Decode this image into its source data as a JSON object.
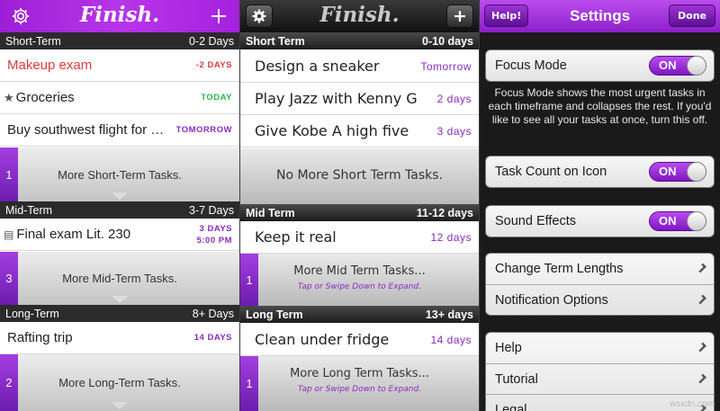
{
  "panel1": {
    "logo": "Finish.",
    "icons": {
      "settings": "gear-icon",
      "add": "plus-icon"
    },
    "short_term": {
      "title": "Short-Term",
      "range": "0-2 Days"
    },
    "short_tasks": [
      {
        "title": "Makeup exam",
        "due": "-2 DAYS",
        "color": "#e23b3b"
      },
      {
        "title": "Groceries",
        "due": "TODAY",
        "color": "#2fb44d",
        "icon": "star-icon"
      },
      {
        "title": "Buy southwest flight for S...",
        "due": "TOMORROW",
        "color": "#8a2bc0"
      }
    ],
    "short_more": {
      "count": "1",
      "label": "More Short-Term Tasks."
    },
    "mid_term": {
      "title": "Mid-Term",
      "range": "3-7 Days"
    },
    "mid_tasks": [
      {
        "title": "Final exam Lit. 230",
        "due": "3 DAYS",
        "time": "5:00 PM",
        "icon": "note-icon"
      }
    ],
    "mid_more": {
      "count": "3",
      "label": "More Mid-Term Tasks."
    },
    "long_term": {
      "title": "Long-Term",
      "range": "8+ Days"
    },
    "long_tasks": [
      {
        "title": "Rafting trip",
        "due": "14 DAYS"
      }
    ],
    "long_more": {
      "count": "2",
      "label": "More Long-Term Tasks."
    }
  },
  "panel2": {
    "logo": "Finish.",
    "icons": {
      "settings": "gear-icon",
      "add": "plus-icon"
    },
    "short_term": {
      "title": "Short Term",
      "range": "0-10 days"
    },
    "short_tasks": [
      {
        "title": "Design a sneaker",
        "due": "Tomorrow"
      },
      {
        "title": "Play Jazz with Kenny G",
        "due": "2 days"
      },
      {
        "title": "Give Kobe A high five",
        "due": "3 days"
      }
    ],
    "short_empty": "No More Short Term Tasks.",
    "mid_term": {
      "title": "Mid Term",
      "range": "11-12 days"
    },
    "mid_tasks": [
      {
        "title": "Keep it real",
        "due": "12 days"
      }
    ],
    "mid_more": {
      "count": "1",
      "label": "More Mid Term Tasks...",
      "hint": "Tap or Swipe Down to Expand."
    },
    "long_term": {
      "title": "Long Term",
      "range": "13+ days"
    },
    "long_tasks": [
      {
        "title": "Clean under fridge",
        "due": "14 days"
      }
    ],
    "long_more": {
      "count": "1",
      "label": "More Long Term Tasks...",
      "hint": "Tap or Swipe Down to Expand."
    }
  },
  "panel3": {
    "help_button": "Help!",
    "title": "Settings",
    "done_button": "Done",
    "focus_mode": {
      "label": "Focus Mode",
      "state": "ON"
    },
    "focus_note": "Focus Mode shows the most urgent tasks in each timeframe and collapses the rest. If you'd like to see all your tasks at once, turn this off.",
    "task_count": {
      "label": "Task Count on Icon",
      "state": "ON"
    },
    "sound_effects": {
      "label": "Sound Effects",
      "state": "ON"
    },
    "nav1": [
      "Change Term Lengths",
      "Notification Options"
    ],
    "nav2": [
      "Help",
      "Tutorial",
      "Legal"
    ]
  },
  "watermark": "wsxdn.com",
  "colors": {
    "accent": "#9d1fd6",
    "today": "#2fb44d",
    "overdue": "#e23b3b",
    "date": "#8a2bc0"
  }
}
